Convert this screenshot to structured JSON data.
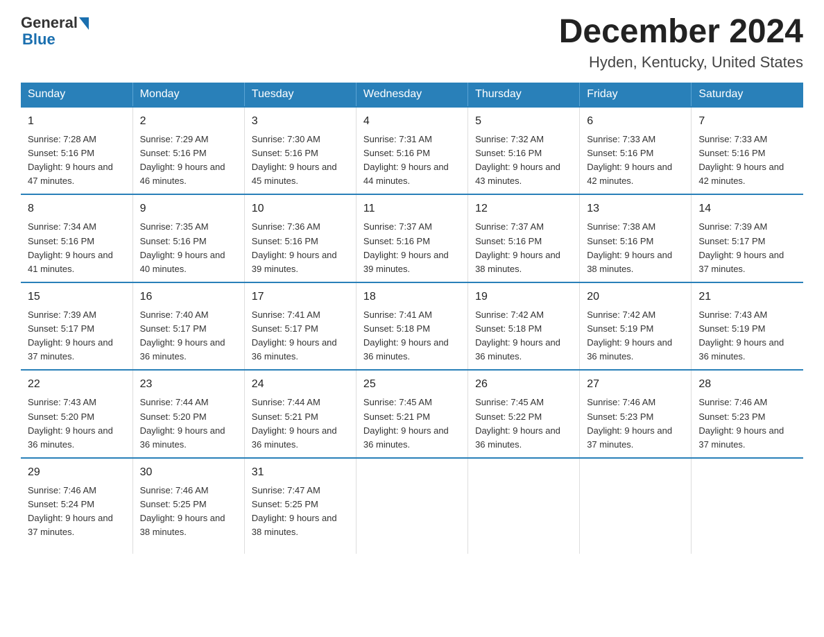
{
  "header": {
    "logo_general": "General",
    "logo_blue": "Blue",
    "month_title": "December 2024",
    "location": "Hyden, Kentucky, United States"
  },
  "days_of_week": [
    "Sunday",
    "Monday",
    "Tuesday",
    "Wednesday",
    "Thursday",
    "Friday",
    "Saturday"
  ],
  "weeks": [
    [
      {
        "day": "1",
        "sunrise": "7:28 AM",
        "sunset": "5:16 PM",
        "daylight": "9 hours and 47 minutes."
      },
      {
        "day": "2",
        "sunrise": "7:29 AM",
        "sunset": "5:16 PM",
        "daylight": "9 hours and 46 minutes."
      },
      {
        "day": "3",
        "sunrise": "7:30 AM",
        "sunset": "5:16 PM",
        "daylight": "9 hours and 45 minutes."
      },
      {
        "day": "4",
        "sunrise": "7:31 AM",
        "sunset": "5:16 PM",
        "daylight": "9 hours and 44 minutes."
      },
      {
        "day": "5",
        "sunrise": "7:32 AM",
        "sunset": "5:16 PM",
        "daylight": "9 hours and 43 minutes."
      },
      {
        "day": "6",
        "sunrise": "7:33 AM",
        "sunset": "5:16 PM",
        "daylight": "9 hours and 42 minutes."
      },
      {
        "day": "7",
        "sunrise": "7:33 AM",
        "sunset": "5:16 PM",
        "daylight": "9 hours and 42 minutes."
      }
    ],
    [
      {
        "day": "8",
        "sunrise": "7:34 AM",
        "sunset": "5:16 PM",
        "daylight": "9 hours and 41 minutes."
      },
      {
        "day": "9",
        "sunrise": "7:35 AM",
        "sunset": "5:16 PM",
        "daylight": "9 hours and 40 minutes."
      },
      {
        "day": "10",
        "sunrise": "7:36 AM",
        "sunset": "5:16 PM",
        "daylight": "9 hours and 39 minutes."
      },
      {
        "day": "11",
        "sunrise": "7:37 AM",
        "sunset": "5:16 PM",
        "daylight": "9 hours and 39 minutes."
      },
      {
        "day": "12",
        "sunrise": "7:37 AM",
        "sunset": "5:16 PM",
        "daylight": "9 hours and 38 minutes."
      },
      {
        "day": "13",
        "sunrise": "7:38 AM",
        "sunset": "5:16 PM",
        "daylight": "9 hours and 38 minutes."
      },
      {
        "day": "14",
        "sunrise": "7:39 AM",
        "sunset": "5:17 PM",
        "daylight": "9 hours and 37 minutes."
      }
    ],
    [
      {
        "day": "15",
        "sunrise": "7:39 AM",
        "sunset": "5:17 PM",
        "daylight": "9 hours and 37 minutes."
      },
      {
        "day": "16",
        "sunrise": "7:40 AM",
        "sunset": "5:17 PM",
        "daylight": "9 hours and 36 minutes."
      },
      {
        "day": "17",
        "sunrise": "7:41 AM",
        "sunset": "5:17 PM",
        "daylight": "9 hours and 36 minutes."
      },
      {
        "day": "18",
        "sunrise": "7:41 AM",
        "sunset": "5:18 PM",
        "daylight": "9 hours and 36 minutes."
      },
      {
        "day": "19",
        "sunrise": "7:42 AM",
        "sunset": "5:18 PM",
        "daylight": "9 hours and 36 minutes."
      },
      {
        "day": "20",
        "sunrise": "7:42 AM",
        "sunset": "5:19 PM",
        "daylight": "9 hours and 36 minutes."
      },
      {
        "day": "21",
        "sunrise": "7:43 AM",
        "sunset": "5:19 PM",
        "daylight": "9 hours and 36 minutes."
      }
    ],
    [
      {
        "day": "22",
        "sunrise": "7:43 AM",
        "sunset": "5:20 PM",
        "daylight": "9 hours and 36 minutes."
      },
      {
        "day": "23",
        "sunrise": "7:44 AM",
        "sunset": "5:20 PM",
        "daylight": "9 hours and 36 minutes."
      },
      {
        "day": "24",
        "sunrise": "7:44 AM",
        "sunset": "5:21 PM",
        "daylight": "9 hours and 36 minutes."
      },
      {
        "day": "25",
        "sunrise": "7:45 AM",
        "sunset": "5:21 PM",
        "daylight": "9 hours and 36 minutes."
      },
      {
        "day": "26",
        "sunrise": "7:45 AM",
        "sunset": "5:22 PM",
        "daylight": "9 hours and 36 minutes."
      },
      {
        "day": "27",
        "sunrise": "7:46 AM",
        "sunset": "5:23 PM",
        "daylight": "9 hours and 37 minutes."
      },
      {
        "day": "28",
        "sunrise": "7:46 AM",
        "sunset": "5:23 PM",
        "daylight": "9 hours and 37 minutes."
      }
    ],
    [
      {
        "day": "29",
        "sunrise": "7:46 AM",
        "sunset": "5:24 PM",
        "daylight": "9 hours and 37 minutes."
      },
      {
        "day": "30",
        "sunrise": "7:46 AM",
        "sunset": "5:25 PM",
        "daylight": "9 hours and 38 minutes."
      },
      {
        "day": "31",
        "sunrise": "7:47 AM",
        "sunset": "5:25 PM",
        "daylight": "9 hours and 38 minutes."
      },
      null,
      null,
      null,
      null
    ]
  ]
}
